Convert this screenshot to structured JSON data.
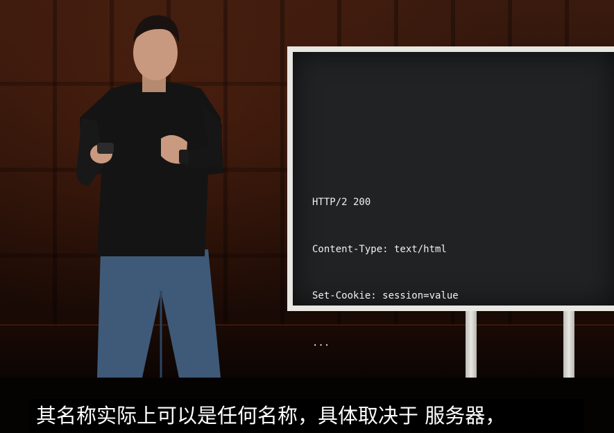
{
  "slide": {
    "lines": [
      "HTTP/2 200",
      "Content-Type: text/html",
      "Set-Cookie: session=value",
      "..."
    ]
  },
  "subtitle": {
    "text": "其名称实际上可以是任何名称，具体取决于 服务器，"
  },
  "colors": {
    "screen_background": "#202224",
    "screen_text": "#f1f1f1",
    "board_frame": "#e9e7e2",
    "wood_backdrop": "#2a120a",
    "subtitle_text": "#ffffff"
  }
}
